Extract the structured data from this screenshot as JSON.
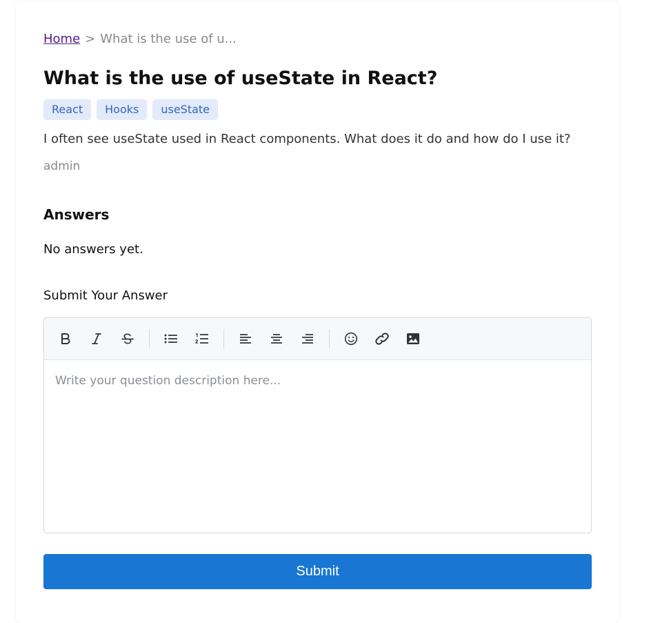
{
  "breadcrumb": {
    "home_label": "Home",
    "separator": ">",
    "current": "What is the use of u..."
  },
  "question": {
    "title": "What is the use of useState in React?",
    "tags": [
      "React",
      "Hooks",
      "useState"
    ],
    "body": "I often see useState used in React components. What does it do and how do I use it?",
    "author": "admin"
  },
  "answers": {
    "heading": "Answers",
    "empty_text": "No answers yet."
  },
  "answer_form": {
    "label": "Submit Your Answer",
    "placeholder": "Write your question description here...",
    "toolbar_icons": [
      "bold-icon",
      "italic-icon",
      "strikethrough-icon",
      "bullet-list-icon",
      "numbered-list-icon",
      "align-left-icon",
      "align-center-icon",
      "align-right-icon",
      "emoji-icon",
      "link-icon",
      "image-icon"
    ],
    "submit_label": "Submit"
  },
  "colors": {
    "accent": "#1976d2",
    "tag_bg": "#e3eaf9",
    "tag_text": "#2f67bd",
    "link_visited": "#551a8b"
  }
}
